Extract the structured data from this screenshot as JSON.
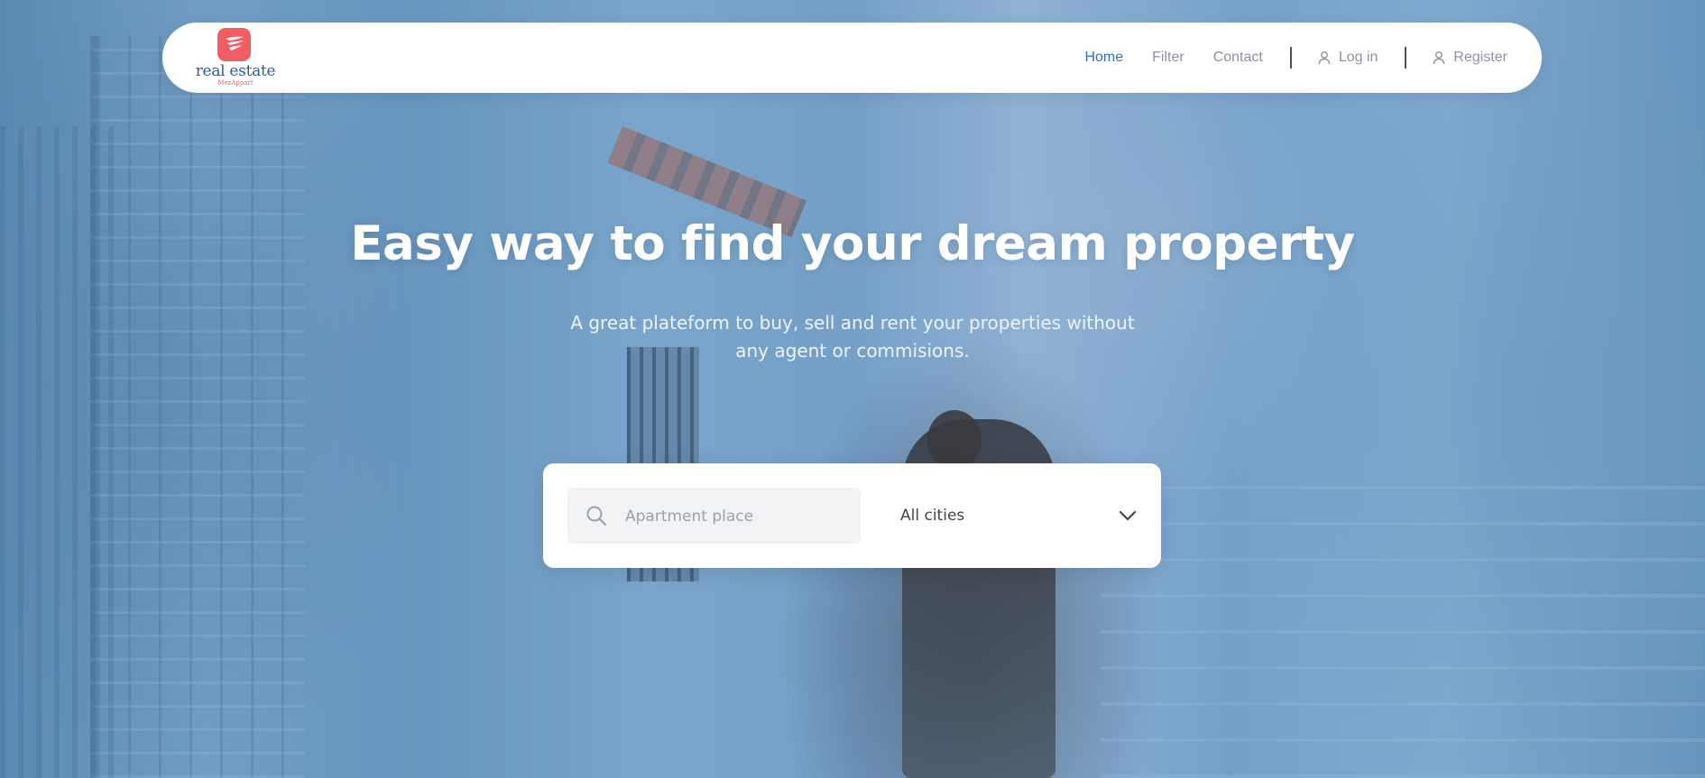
{
  "brand": {
    "name": "real estate",
    "tagline": "MezAppart"
  },
  "nav": {
    "links": [
      {
        "label": "Home",
        "active": true
      },
      {
        "label": "Filter",
        "active": false
      },
      {
        "label": "Contact",
        "active": false
      }
    ],
    "login_label": "Log in",
    "register_label": "Register"
  },
  "hero": {
    "headline": "Easy way to find your dream property",
    "subheadline": "A great plateform to buy, sell and rent your properties without any agent or commisions."
  },
  "search": {
    "placeholder": "Apartment place",
    "value": "",
    "city_selected": "All cities"
  },
  "colors": {
    "accent": "#2f6fdd",
    "brand": "#f25d63",
    "muted": "#8a94a6"
  },
  "icons": {
    "logo": "bird-wing-icon",
    "search": "search-icon",
    "user": "user-icon",
    "dropdown": "chevron-down-icon"
  }
}
